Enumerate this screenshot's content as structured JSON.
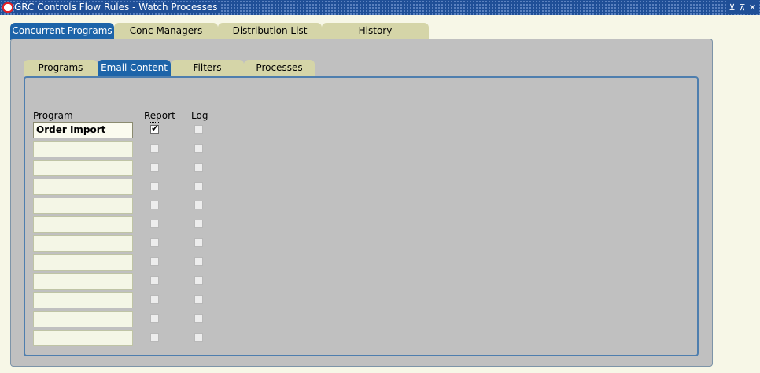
{
  "window": {
    "title": "GRC Controls Flow Rules - Watch Processes",
    "controls": [
      "minimize-icon",
      "maximize-icon",
      "close-icon"
    ],
    "minimize_glyph": "⊻",
    "maximize_glyph": "⊼",
    "close_glyph": "✕"
  },
  "outer_tabs": [
    {
      "label": "Concurrent Programs",
      "active": true
    },
    {
      "label": "Conc Managers",
      "active": false
    },
    {
      "label": "Distribution List",
      "active": false
    },
    {
      "label": "History",
      "active": false
    }
  ],
  "inner_tabs": [
    {
      "label": "Programs",
      "active": false
    },
    {
      "label": "Email Content",
      "active": true
    },
    {
      "label": "Filters",
      "active": false
    },
    {
      "label": "Processes",
      "active": false
    }
  ],
  "columns": {
    "program": "Program",
    "report": "Report",
    "log": "Log"
  },
  "rows": [
    {
      "program": "Order Import",
      "report": true,
      "log": false
    },
    {
      "program": "",
      "report": false,
      "log": false
    },
    {
      "program": "",
      "report": false,
      "log": false
    },
    {
      "program": "",
      "report": false,
      "log": false
    },
    {
      "program": "",
      "report": false,
      "log": false
    },
    {
      "program": "",
      "report": false,
      "log": false
    },
    {
      "program": "",
      "report": false,
      "log": false
    },
    {
      "program": "",
      "report": false,
      "log": false
    },
    {
      "program": "",
      "report": false,
      "log": false
    },
    {
      "program": "",
      "report": false,
      "log": false
    },
    {
      "program": "",
      "report": false,
      "log": false
    },
    {
      "program": "",
      "report": false,
      "log": false
    }
  ],
  "colors": {
    "titlebar": "#1f4f97",
    "active_tab": "#1d64a9",
    "inactive_tab": "#d5d5a8",
    "panel": "#c0c0c0"
  }
}
